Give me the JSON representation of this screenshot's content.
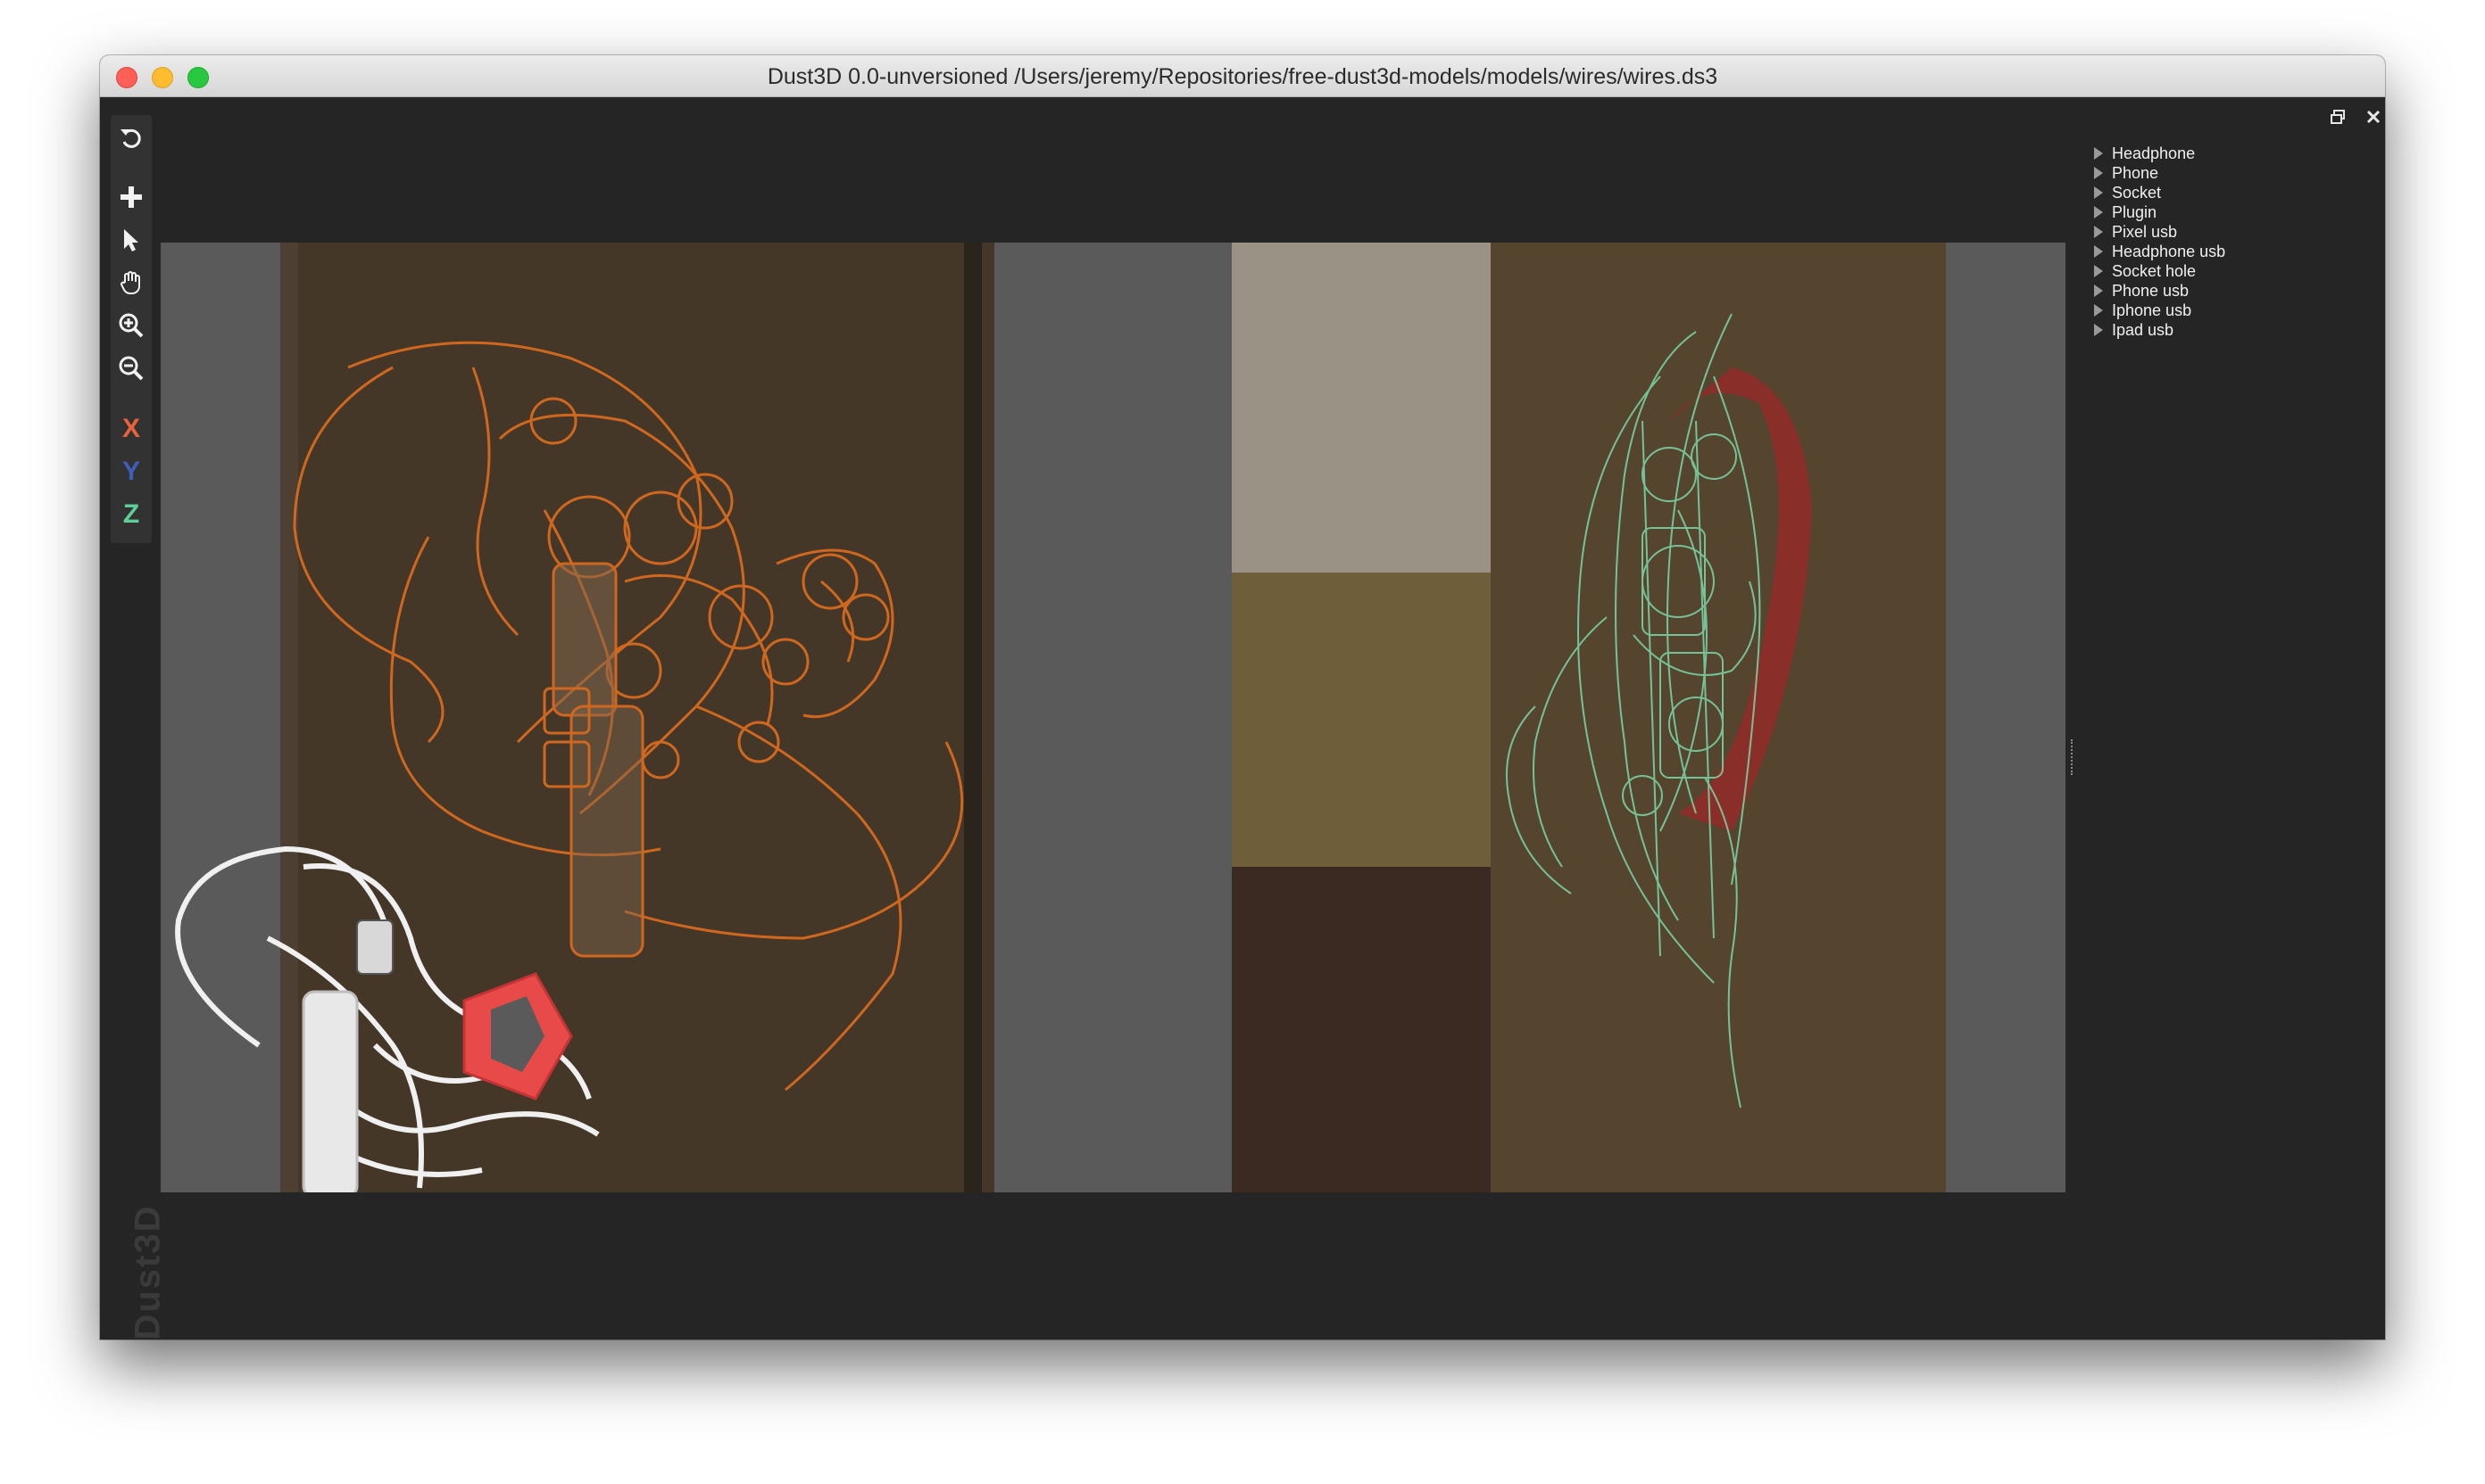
{
  "window": {
    "title": "Dust3D 0.0-unversioned /Users/jeremy/Repositories/free-dust3d-models/models/wires/wires.ds3"
  },
  "toolbar": {
    "tools": [
      {
        "name": "undo",
        "icon": "undo-icon"
      },
      {
        "name": "add",
        "icon": "plus-icon"
      },
      {
        "name": "select",
        "icon": "pointer-icon"
      },
      {
        "name": "drag",
        "icon": "hand-icon"
      },
      {
        "name": "zoom-in",
        "icon": "zoom-in-icon"
      },
      {
        "name": "zoom-out",
        "icon": "zoom-out-icon"
      }
    ],
    "axis_x": "X",
    "axis_y": "Y",
    "axis_z": "Z",
    "axis_colors": {
      "x": "#e8623a",
      "y": "#3d5fb8",
      "z": "#5fcf9a"
    }
  },
  "branding": {
    "logo_text": "Dust3D"
  },
  "panel": {
    "restore_icon": "restore-window-icon",
    "close_icon": "close-icon",
    "parts": [
      "Headphone",
      "Phone",
      "Socket",
      "Plugin",
      "Pixel usb",
      "Headphone usb",
      "Socket hole",
      "Phone usb",
      "Iphone usb",
      "Ipad usb"
    ]
  },
  "colors": {
    "front_view_wire": "#e8701e",
    "side_view_wire": "#7fe0b0",
    "preview_model": "#f0f0f0",
    "headphone_accent": "#e84a4a"
  }
}
